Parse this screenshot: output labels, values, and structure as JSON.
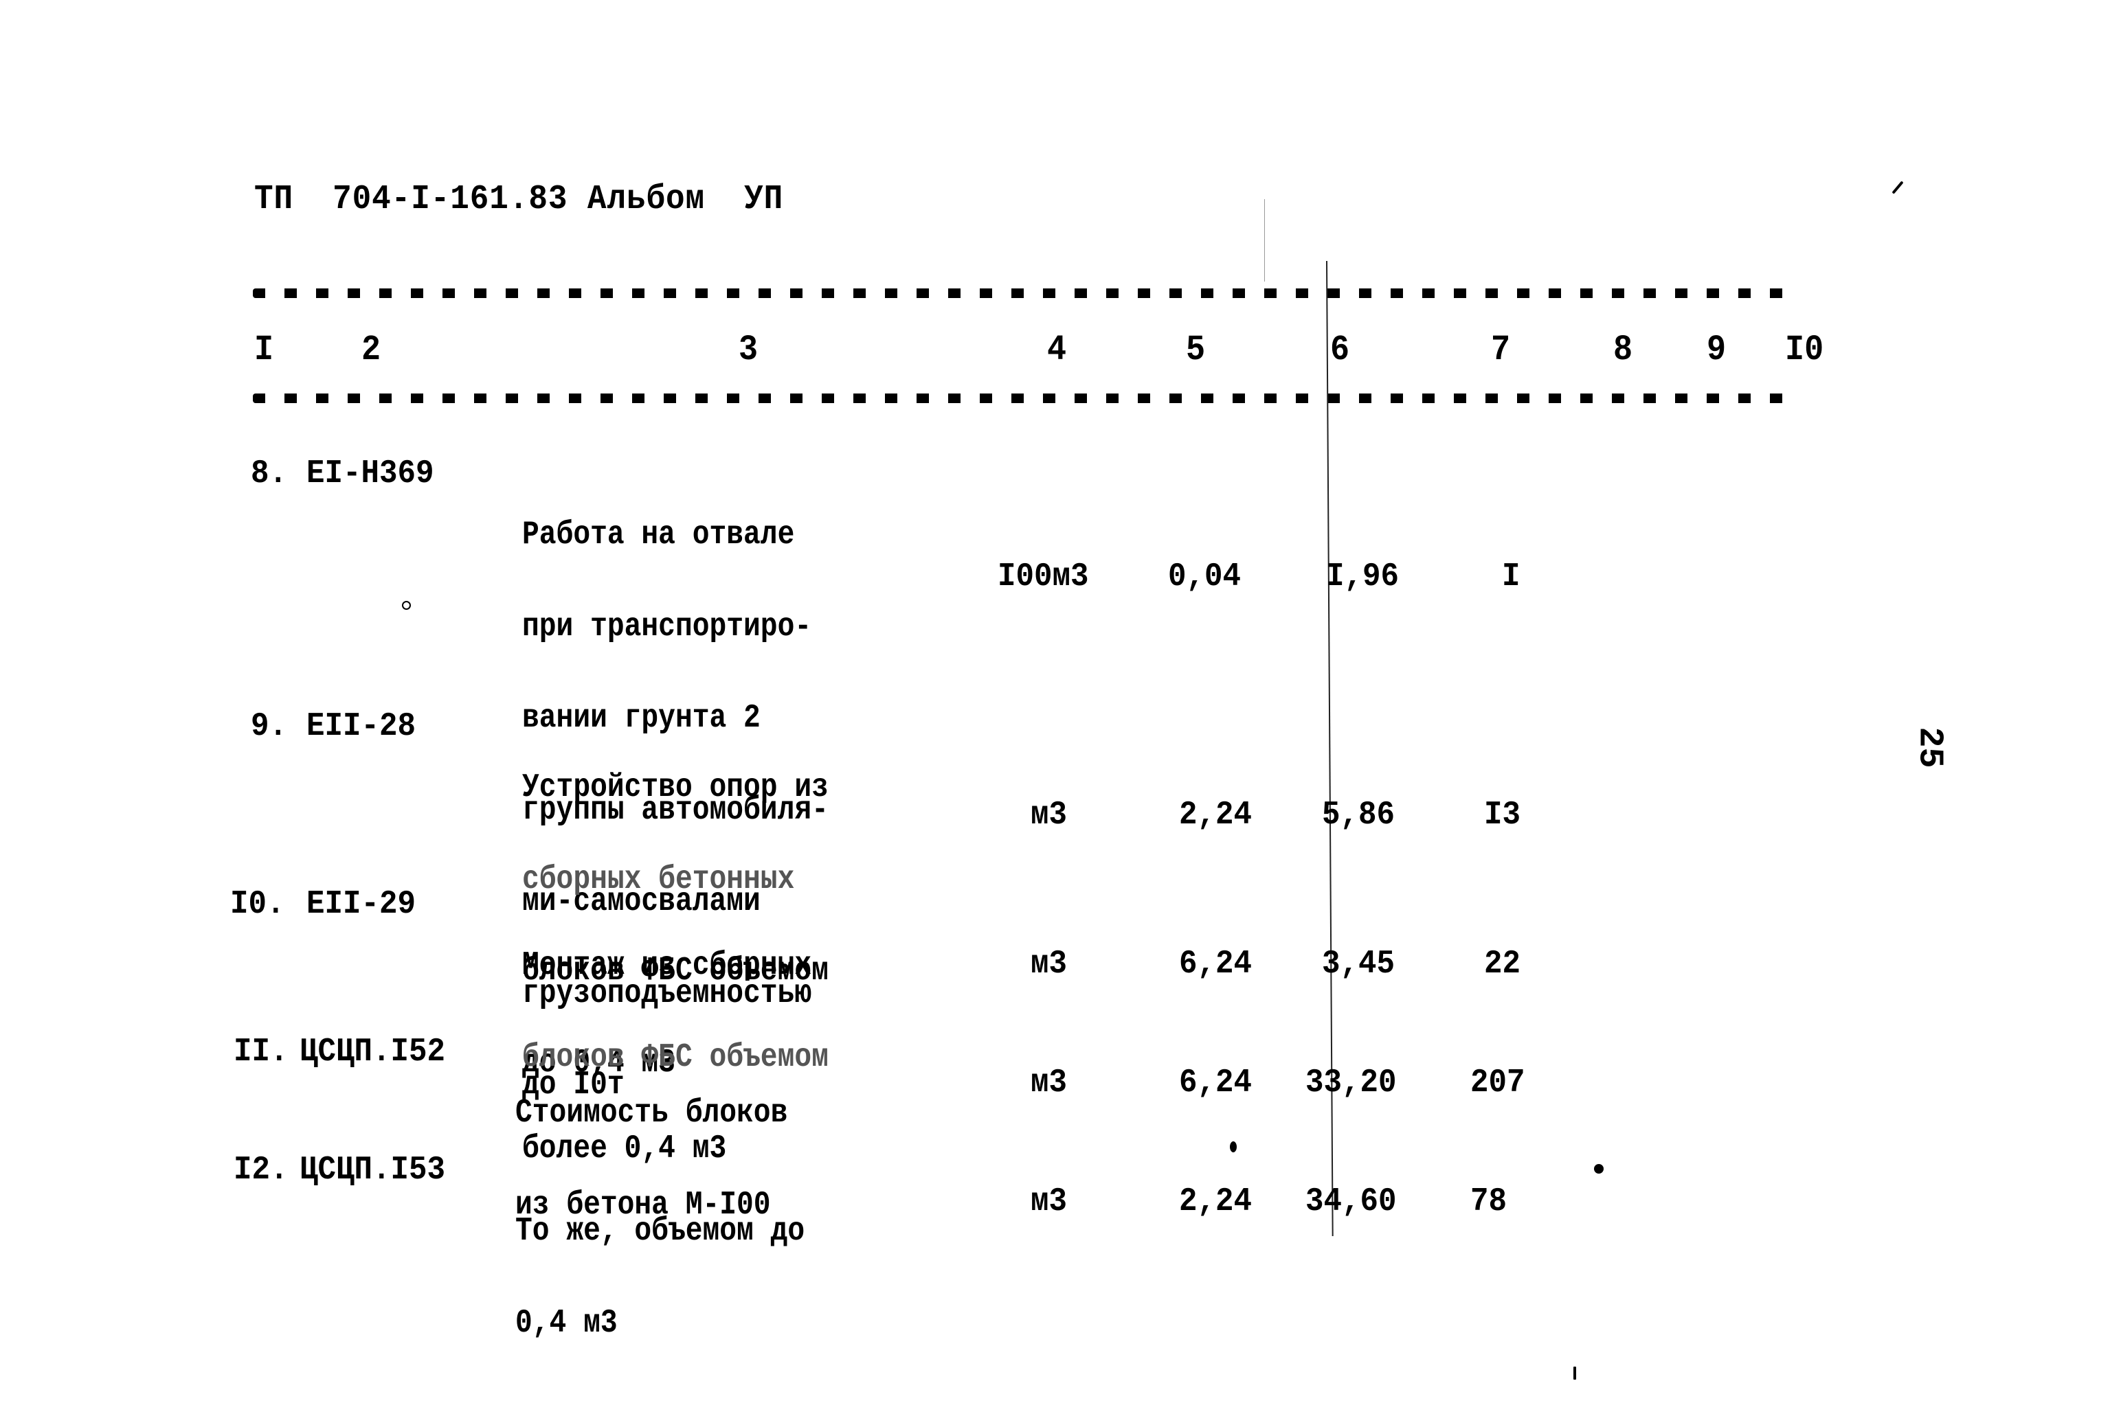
{
  "header": {
    "title": "ТП  704-I-161.83 Альбом  УП"
  },
  "table": {
    "column_numbers": [
      "I",
      "2",
      "3",
      "4",
      "5",
      "6",
      "7",
      "8",
      "9",
      "I0"
    ],
    "rows": [
      {
        "number": "8.",
        "code": "EI-H369",
        "description_lines": [
          "Работа на отвале",
          "при транспортиро-",
          "вании грунта 2",
          "группы автомобиля-",
          "ми-самосвалами",
          "грузоподъемностью",
          "до I0т"
        ],
        "unit": "I00м3",
        "quantity": "0,04",
        "unit_cost": "I,96",
        "total": "I"
      },
      {
        "number": "9.",
        "code": "EII-28",
        "description_lines": [
          "Устройство опор из",
          "сборных бетонных",
          "блоков ФБС объемом",
          "до 0,4 м3"
        ],
        "unit": "м3",
        "quantity": "2,24",
        "unit_cost": "5,86",
        "total": "I3"
      },
      {
        "number": "I0.",
        "code": "EII-29",
        "description_lines": [
          "Монтаж из сборных",
          "блоков ФБС объемом",
          "более 0,4 м3"
        ],
        "unit": "м3",
        "quantity": "6,24",
        "unit_cost": "3,45",
        "total": "22"
      },
      {
        "number": "II.",
        "code": "ЦСЦП.I52",
        "description_lines": [
          "Стоимость блоков",
          "из бетона М-I00"
        ],
        "unit": "м3",
        "quantity": "6,24",
        "unit_cost": "33,20",
        "total": "207"
      },
      {
        "number": "I2.",
        "code": "ЦСЦП.I53",
        "description_lines": [
          "То же, объемом до",
          "0,4 м3"
        ],
        "unit": "м3",
        "quantity": "2,24",
        "unit_cost": "34,60",
        "total": "78"
      }
    ]
  },
  "page_number": "25"
}
